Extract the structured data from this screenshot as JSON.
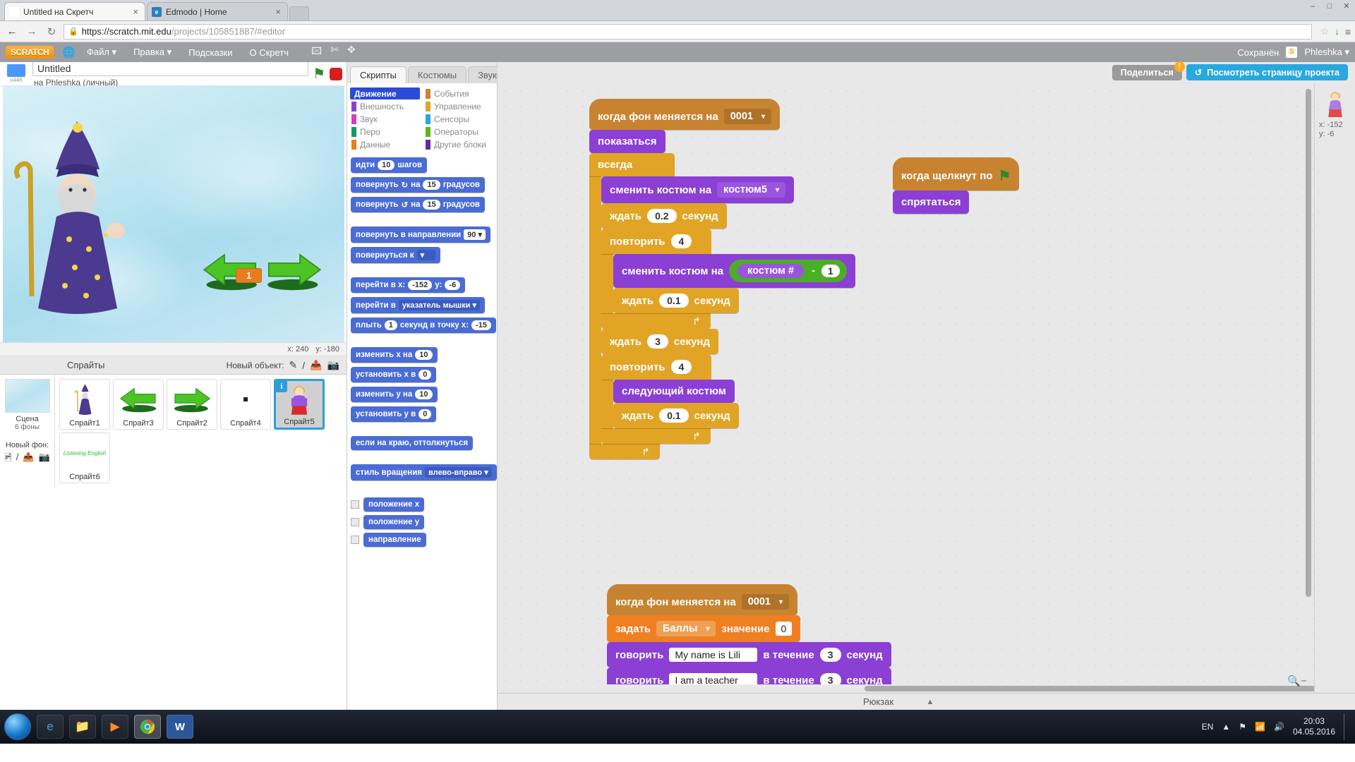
{
  "browser": {
    "tabs": [
      {
        "title": "Untitled на Скретч",
        "favicon": "scratch-favicon",
        "active": true,
        "close": "×"
      },
      {
        "title": "Edmodo | Home",
        "favicon": "edmodo-favicon",
        "active": false,
        "close": "×"
      }
    ],
    "nav": {
      "back": "←",
      "forward": "→",
      "reload": "↻"
    },
    "url_secure_icon": "lock-icon",
    "url_domain": "https://scratch.mit.edu",
    "url_path": "/projects/105851887/#editor",
    "star_icon": "☆",
    "download_icon": "↓",
    "menu_icon": "≡",
    "window_controls": [
      "–",
      "□",
      "✕"
    ]
  },
  "scratch_menu": {
    "logo": "SCRATCH",
    "globe_icon": "🌐",
    "items": [
      "Файл ▾",
      "Правка ▾",
      "Подсказки",
      "О Скретч"
    ],
    "icons": [
      "stamp-icon",
      "scissors-icon",
      "expand-icon"
    ],
    "saved_status": "Сохранён",
    "user_icon": "S",
    "username": "Phleshka ▾"
  },
  "project": {
    "small_stage_icon": "small-stage-icon",
    "version": "v446",
    "title_value": "Untitled",
    "title_placeholder": "Untitled",
    "owner": "на Phleshka (личный)",
    "green_flag_icon": "⚑",
    "stop_icon": "stop-icon"
  },
  "stage": {
    "number_overlay": "1",
    "coords": {
      "x_label": "x:",
      "x_value": "240",
      "y_label": "y:",
      "y_value": "-180"
    }
  },
  "sprite_panel": {
    "header_label": "Спрайты",
    "new_object_label": "Новый объект:",
    "new_object_icons": [
      "paint-brush-icon",
      "paint-line-icon",
      "upload-icon",
      "camera-icon"
    ],
    "stage_name": "Сцена",
    "stage_backdrops": "6 фоны",
    "new_backdrop_label": "Новый фон:",
    "new_backdrop_icons": [
      "image-icon",
      "paint-line-icon",
      "upload-icon",
      "camera-icon"
    ],
    "sprites": [
      {
        "name": "Спрайт1",
        "kind": "wizard",
        "selected": false,
        "badge": ""
      },
      {
        "name": "Спрайт3",
        "kind": "arrow-left",
        "selected": false,
        "badge": ""
      },
      {
        "name": "Спрайт2",
        "kind": "arrow-right",
        "selected": false,
        "badge": ""
      },
      {
        "name": "Спрайт4",
        "kind": "dot",
        "selected": false,
        "badge": ""
      },
      {
        "name": "Спрайт5",
        "kind": "girl",
        "selected": true,
        "badge": "i"
      },
      {
        "name": "Спрайт6",
        "kind": "text",
        "selected": false,
        "badge": ""
      }
    ],
    "sprite6_thumb_text": "Listening English"
  },
  "tabs": [
    {
      "label": "Скрипты",
      "active": true
    },
    {
      "label": "Костюмы",
      "active": false
    },
    {
      "label": "Звуки",
      "active": false
    }
  ],
  "categories": [
    {
      "label": "Движение",
      "color": "#4a6cd4",
      "active": true
    },
    {
      "label": "События",
      "color": "#c88330",
      "active": false
    },
    {
      "label": "Внешность",
      "color": "#8b3fd4",
      "active": false
    },
    {
      "label": "Управление",
      "color": "#e1a425",
      "active": false
    },
    {
      "label": "Звук",
      "color": "#cf3ec4",
      "active": false
    },
    {
      "label": "Сенсоры",
      "color": "#2ca5e2",
      "active": false
    },
    {
      "label": "Перо",
      "color": "#0e9a6c",
      "active": false
    },
    {
      "label": "Операторы",
      "color": "#5cb712",
      "active": false
    },
    {
      "label": "Данные",
      "color": "#ee7d16",
      "active": false
    },
    {
      "label": "Другие блоки",
      "color": "#632d99",
      "active": false
    }
  ],
  "palette_blocks": [
    {
      "id": "move",
      "parts": [
        {
          "t": "text",
          "v": "идти"
        },
        {
          "t": "oval",
          "v": "10"
        },
        {
          "t": "text",
          "v": "шагов"
        }
      ]
    },
    {
      "id": "turn-cw",
      "parts": [
        {
          "t": "text",
          "v": "повернуть"
        },
        {
          "t": "text",
          "v": "↻"
        },
        {
          "t": "text",
          "v": "на"
        },
        {
          "t": "oval",
          "v": "15"
        },
        {
          "t": "text",
          "v": "градусов"
        }
      ]
    },
    {
      "id": "turn-ccw",
      "parts": [
        {
          "t": "text",
          "v": "повернуть"
        },
        {
          "t": "text",
          "v": "↺"
        },
        {
          "t": "text",
          "v": "на"
        },
        {
          "t": "oval",
          "v": "15"
        },
        {
          "t": "text",
          "v": "градусов"
        }
      ]
    },
    {
      "id": "point-direction",
      "gap": true,
      "parts": [
        {
          "t": "text",
          "v": "повернуть в направлении"
        },
        {
          "t": "drop",
          "v": "90 ▾"
        }
      ]
    },
    {
      "id": "point-towards",
      "parts": [
        {
          "t": "text",
          "v": "повернуться к"
        },
        {
          "t": "drop",
          "v": "▾"
        }
      ]
    },
    {
      "id": "go-to-xy",
      "gap": true,
      "parts": [
        {
          "t": "text",
          "v": "перейти в x:"
        },
        {
          "t": "oval",
          "v": "-152"
        },
        {
          "t": "text",
          "v": "y:"
        },
        {
          "t": "oval",
          "v": "-6"
        }
      ]
    },
    {
      "id": "go-to",
      "parts": [
        {
          "t": "text",
          "v": "перейти в"
        },
        {
          "t": "drop",
          "v": "указатель мышки ▾"
        }
      ]
    },
    {
      "id": "glide",
      "parts": [
        {
          "t": "text",
          "v": "плыть"
        },
        {
          "t": "oval",
          "v": "1"
        },
        {
          "t": "text",
          "v": "секунд в точку x:"
        },
        {
          "t": "oval",
          "v": "-15"
        }
      ]
    },
    {
      "id": "change-x",
      "gap": true,
      "parts": [
        {
          "t": "text",
          "v": "изменить x на"
        },
        {
          "t": "oval",
          "v": "10"
        }
      ]
    },
    {
      "id": "set-x",
      "parts": [
        {
          "t": "text",
          "v": "установить x в"
        },
        {
          "t": "oval",
          "v": "0"
        }
      ]
    },
    {
      "id": "change-y",
      "parts": [
        {
          "t": "text",
          "v": "изменить y на"
        },
        {
          "t": "oval",
          "v": "10"
        }
      ]
    },
    {
      "id": "set-y",
      "parts": [
        {
          "t": "text",
          "v": "установить y в"
        },
        {
          "t": "oval",
          "v": "0"
        }
      ]
    },
    {
      "id": "bounce-edge",
      "gap": true,
      "parts": [
        {
          "t": "text",
          "v": "если на краю, оттолкнуться"
        }
      ]
    },
    {
      "id": "rotation-style",
      "gap": true,
      "parts": [
        {
          "t": "text",
          "v": "стиль вращения"
        },
        {
          "t": "drop",
          "v": "влево-вправо ▾"
        }
      ]
    }
  ],
  "palette_watchers": [
    {
      "label": "положение x",
      "checked": false
    },
    {
      "label": "положение y",
      "checked": false
    },
    {
      "label": "направление",
      "checked": false
    }
  ],
  "share": {
    "share_label": "Поделиться",
    "share_badge": "!",
    "page_label": "Посмотреть страницу проекта",
    "page_icon": "refresh-icon"
  },
  "sprite_side_info": {
    "x_label": "x:",
    "x_value": "-152",
    "y_label": "y:",
    "y_value": "-6"
  },
  "scripts": {
    "script1": {
      "hat": {
        "text1": "когда фон меняется на",
        "dropdown": "0001",
        "caret": "▾"
      },
      "show": "показаться",
      "forever": "всегда",
      "switch_costume": {
        "label": "сменить костюм на",
        "dropdown": "костюм5",
        "caret": "▾"
      },
      "wait1": {
        "pre": "ждать",
        "value": "0.2",
        "post": "секунд"
      },
      "repeat1": {
        "label": "повторить",
        "value": "4"
      },
      "switch_costume_expr": {
        "label": "сменить костюм на",
        "operand": "костюм #",
        "op": "-",
        "value": "1"
      },
      "wait2": {
        "pre": "ждать",
        "value": "0.1",
        "post": "секунд"
      },
      "wait3": {
        "pre": "ждать",
        "value": "3",
        "post": "секунд"
      },
      "repeat2": {
        "label": "повторить",
        "value": "4"
      },
      "next_costume": "следующий костюм",
      "wait4": {
        "pre": "ждать",
        "value": "0.1",
        "post": "секунд"
      },
      "loop_arrow": "↱"
    },
    "script2": {
      "hat": {
        "text": "когда щелкнут по",
        "flag_icon": "green-flag-icon"
      },
      "hide": "спрятаться"
    },
    "script3": {
      "hat": {
        "text1": "когда фон меняется на",
        "dropdown": "0001",
        "caret": "▾"
      },
      "set_var": {
        "label": "задать",
        "variable": "Баллы",
        "caret": "▾",
        "mid": "значение",
        "value": "0"
      },
      "say1": {
        "pre": "говорить",
        "text": "My name is Lili",
        "mid": "в течение",
        "value": "3",
        "post": "секунд"
      },
      "say2": {
        "pre": "говорить",
        "text": "I am a teacher",
        "mid": "в течение",
        "value": "3",
        "post": "секунд"
      }
    }
  },
  "zoom_controls": {
    "zoom_out": "−",
    "equals": "=",
    "zoom_in": "+"
  },
  "backpack": {
    "label": "Рюкзак",
    "caret": "▲"
  },
  "taskbar": {
    "start_icon": "windows-start-icon",
    "items": [
      "ie-icon",
      "explorer-icon",
      "media-player-icon",
      "chrome-icon",
      "word-icon"
    ],
    "tray": {
      "language": "EN",
      "arrow": "▲",
      "icons": [
        "flag-icon",
        "network-icon",
        "volume-icon"
      ],
      "time": "20:03",
      "date": "04.05.2016"
    }
  }
}
